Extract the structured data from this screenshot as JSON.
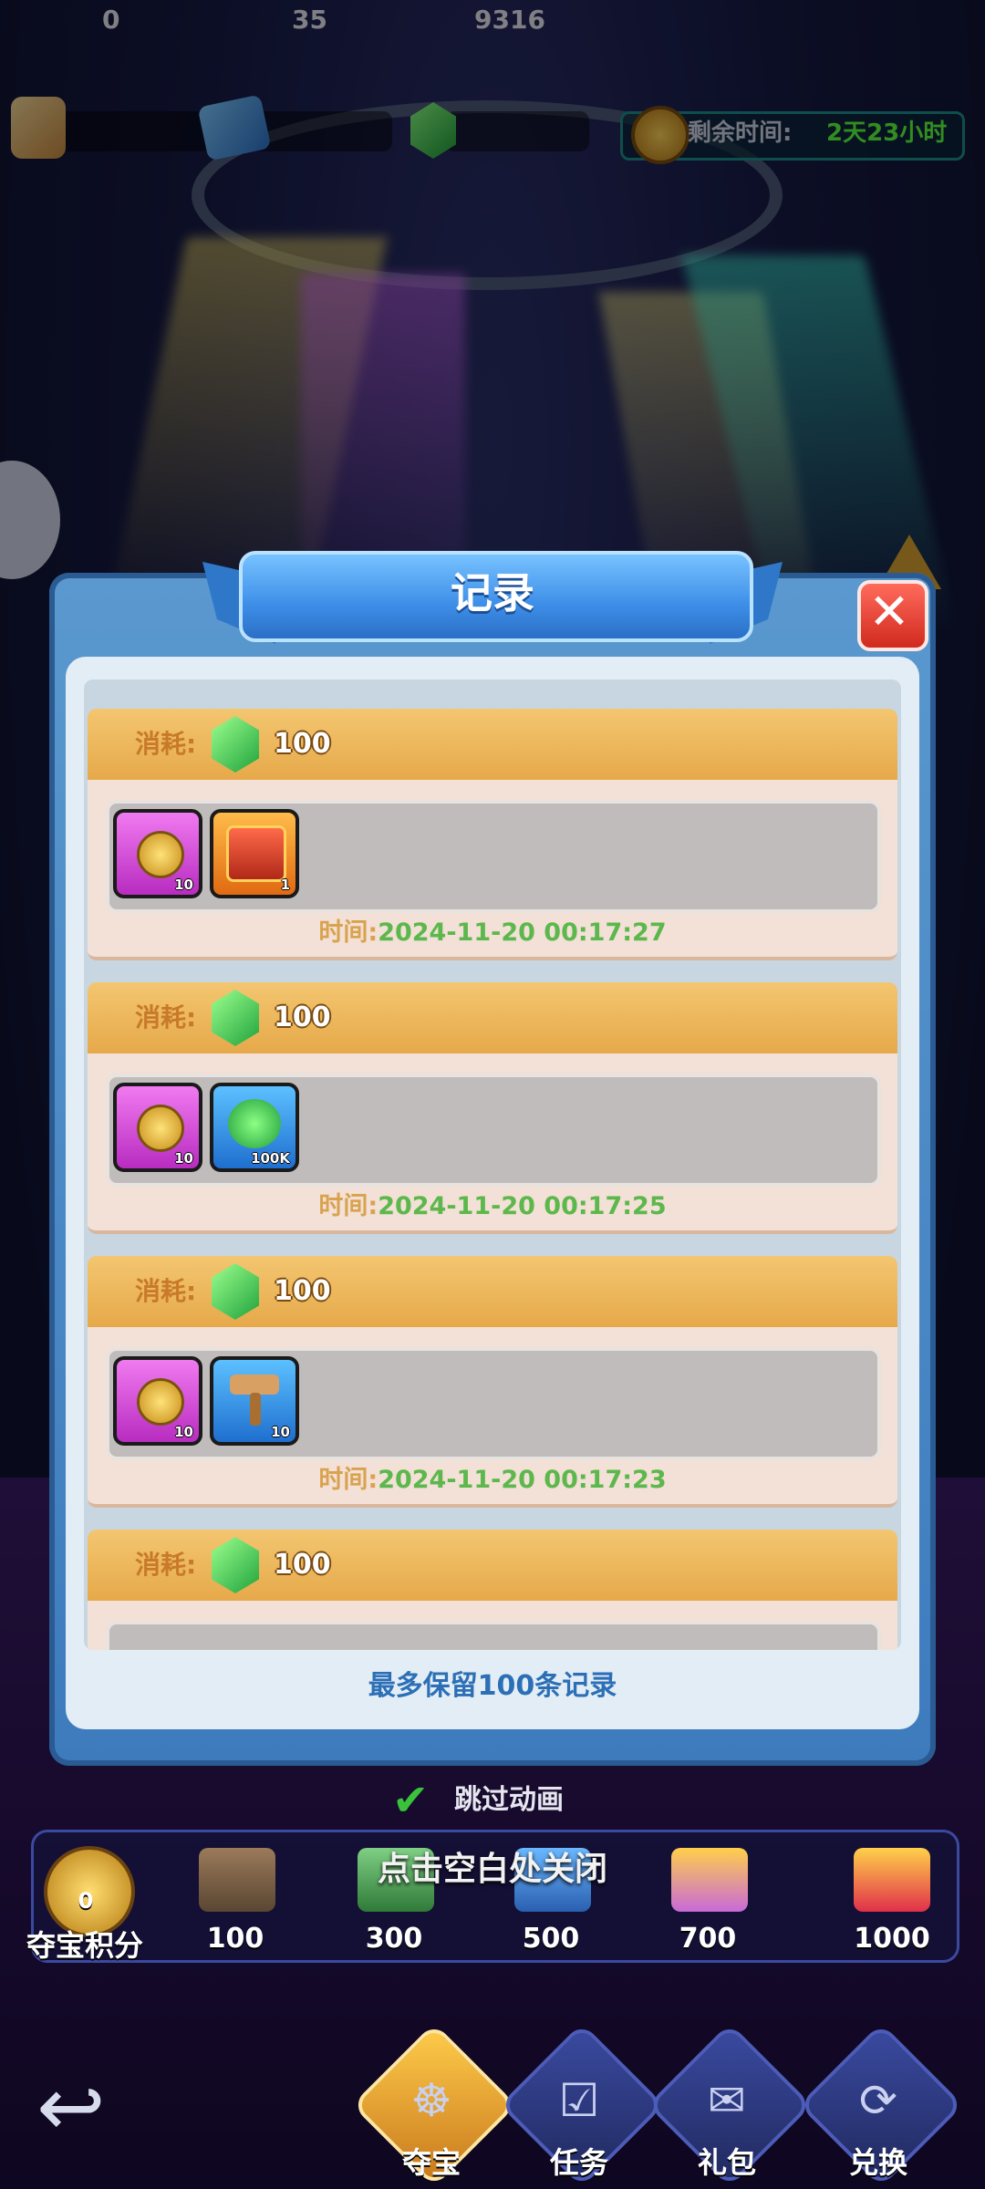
{
  "top_bar": {
    "resources": [
      {
        "icon": "scroll-icon",
        "value": "0"
      },
      {
        "icon": "ticket-icon",
        "value": "35"
      },
      {
        "icon": "gem-icon",
        "value": "9316"
      }
    ],
    "timer": {
      "label": "剩余时间:",
      "value": "2天23小时"
    }
  },
  "dialog": {
    "title": "记录",
    "footnote": "最多保留100条记录",
    "records": [
      {
        "cost_label": "消耗:",
        "cost_value": "100",
        "items": [
          {
            "icon": "gold-coin-icon",
            "qty": "10",
            "frame": "pink"
          },
          {
            "icon": "treasure-chest-icon",
            "qty": "1",
            "frame": "orange"
          }
        ],
        "time_label": "时间:",
        "time_value": "2024-11-20 00:17:27"
      },
      {
        "cost_label": "消耗:",
        "cost_value": "100",
        "items": [
          {
            "icon": "gold-coin-icon",
            "qty": "10",
            "frame": "pink"
          },
          {
            "icon": "green-gem-pile-icon",
            "qty": "100K",
            "frame": "blue"
          }
        ],
        "time_label": "时间:",
        "time_value": "2024-11-20 00:17:25"
      },
      {
        "cost_label": "消耗:",
        "cost_value": "100",
        "items": [
          {
            "icon": "gold-coin-icon",
            "qty": "10",
            "frame": "pink"
          },
          {
            "icon": "hammer-icon",
            "qty": "10",
            "frame": "blue"
          }
        ],
        "time_label": "时间:",
        "time_value": "2024-11-20 00:17:23"
      },
      {
        "cost_label": "消耗:",
        "cost_value": "100"
      }
    ]
  },
  "skip_animation": {
    "label": "跳过动画",
    "checked": true
  },
  "tap_to_close": "点击空白处关闭",
  "progress": {
    "score_label": "夺宝积分",
    "score_value": "0",
    "milestones": [
      "100",
      "300",
      "500",
      "700",
      "1000"
    ]
  },
  "bottom_nav": [
    {
      "label": "夺宝",
      "icon": "wheel-icon",
      "active": true
    },
    {
      "label": "任务",
      "icon": "task-icon",
      "active": false
    },
    {
      "label": "礼包",
      "icon": "gift-cart-icon",
      "active": false
    },
    {
      "label": "兑换",
      "icon": "exchange-icon",
      "active": false
    }
  ],
  "colors": {
    "dialog_blue": "#3e7bbd",
    "header_gold": "#e6a94a",
    "time_green": "#5cb84c",
    "timer_green": "#5cff3c",
    "close_red": "#d12a1e"
  }
}
